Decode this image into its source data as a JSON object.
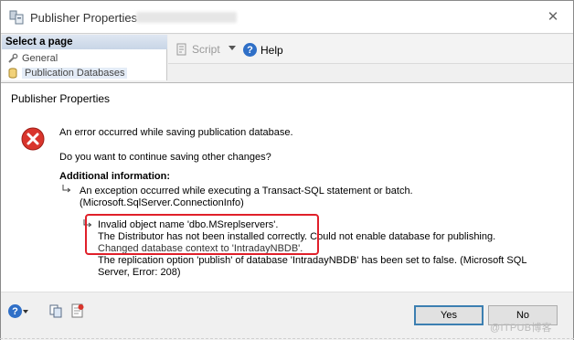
{
  "background_window": {
    "title": "Publisher Properties",
    "select_page_header": "Select a page",
    "pages": [
      {
        "label": "General",
        "icon": "wrench-icon"
      },
      {
        "label": "Publication Databases",
        "icon": "database-icon"
      }
    ],
    "toolbar": {
      "script_label": "Script",
      "help_label": "Help"
    }
  },
  "dialog": {
    "title": "Publisher Properties",
    "error_message": "An error occurred while saving publication database.",
    "question": "Do you want to continue saving other changes?",
    "additional_info_label": "Additional information:",
    "exception_line1": "An exception occurred while executing a Transact-SQL statement or batch.",
    "exception_line2": "(Microsoft.SqlServer.ConnectionInfo)",
    "details": [
      "Invalid object name 'dbo.MSreplservers'.",
      "The Distributor has not been installed correctly. Could not enable database for publishing.",
      "Changed database context to 'IntradayNBDB'.",
      "The replication option 'publish' of database 'IntradayNBDB' has been set to false. (Microsoft SQL",
      "Server, Error: 208)"
    ],
    "buttons": {
      "yes_label": "Yes",
      "no_label": "No"
    },
    "highlight_color": "#e0202a"
  },
  "watermark": "@ITPUB博客"
}
